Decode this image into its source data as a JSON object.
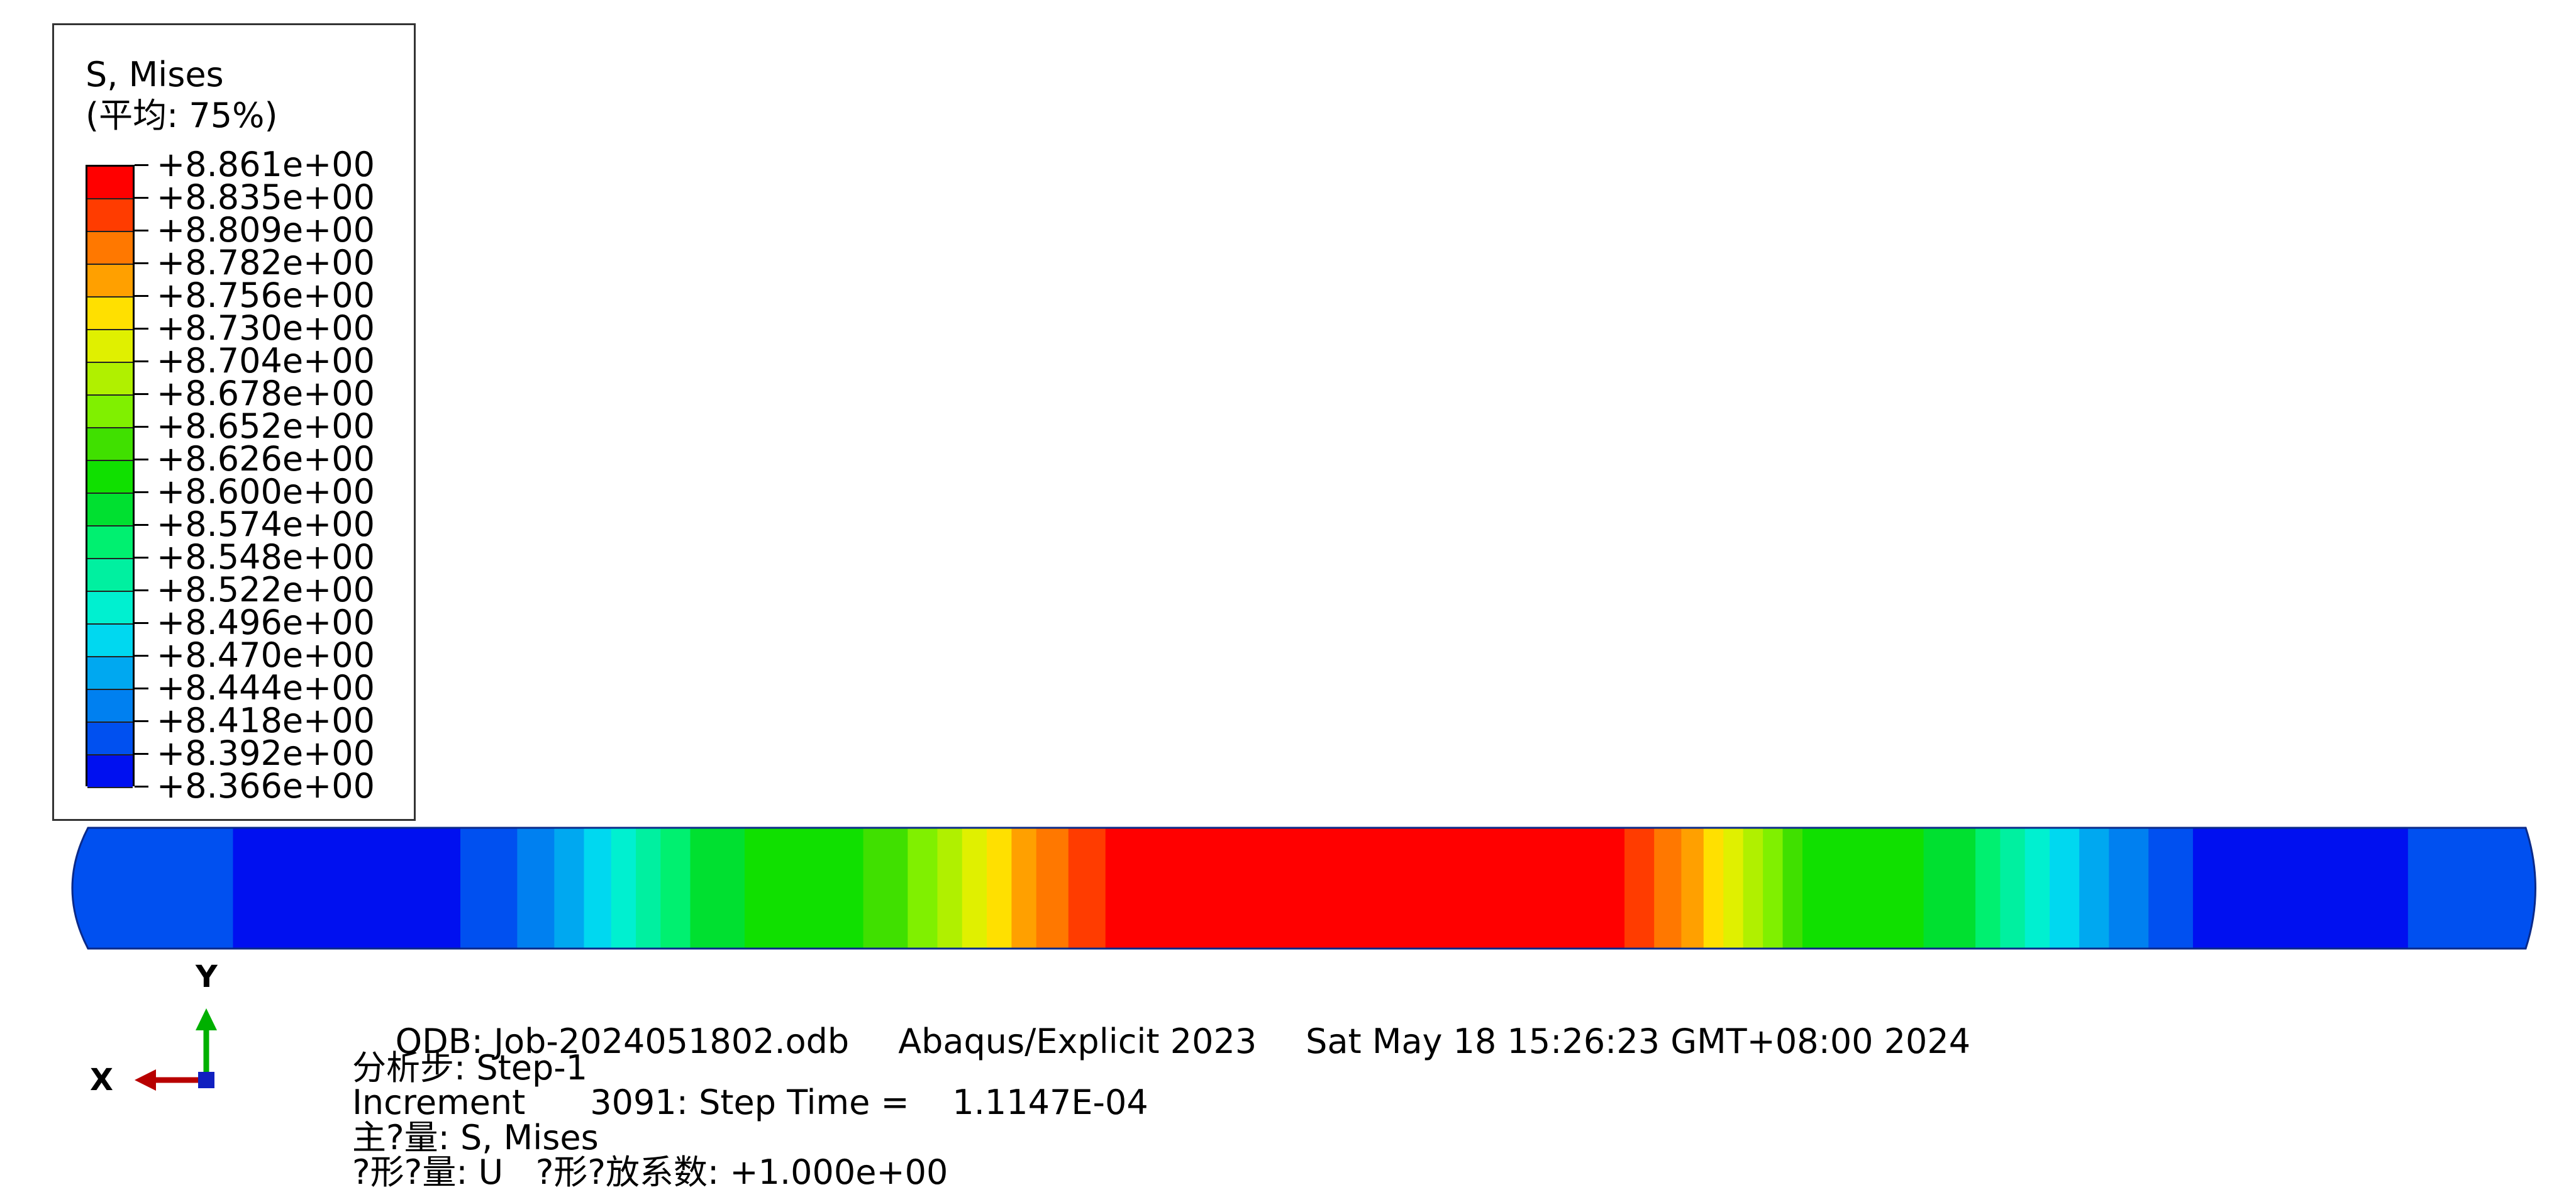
{
  "legend": {
    "title": "S, Mises",
    "subtitle": "(平均: 75%)",
    "labels": [
      "+8.861e+00",
      "+8.835e+00",
      "+8.809e+00",
      "+8.782e+00",
      "+8.756e+00",
      "+8.730e+00",
      "+8.704e+00",
      "+8.678e+00",
      "+8.652e+00",
      "+8.626e+00",
      "+8.600e+00",
      "+8.574e+00",
      "+8.548e+00",
      "+8.522e+00",
      "+8.496e+00",
      "+8.470e+00",
      "+8.444e+00",
      "+8.418e+00",
      "+8.392e+00",
      "+8.366e+00"
    ],
    "colors": [
      "#ff0000",
      "#ff3c00",
      "#ff7800",
      "#ffa000",
      "#ffe000",
      "#e0f000",
      "#b0f000",
      "#80f000",
      "#40e000",
      "#10e000",
      "#00e030",
      "#00f070",
      "#00f0a0",
      "#00f0d0",
      "#00d8f0",
      "#00a8f0",
      "#0080f0",
      "#0050f0",
      "#0010f0"
    ]
  },
  "triad": {
    "x_label": "X",
    "y_label": "Y"
  },
  "info": {
    "odb": "ODB: Job-2024051802.odb",
    "solver": "Abaqus/Explicit 2023",
    "date": "Sat May 18 15:26:23 GMT+08:00 2024",
    "step": "分析步: Step-1",
    "increment": "Increment      3091: Step Time =    1.1147E-04",
    "primary_var": "主?量: S, Mises",
    "deformed_var": "?形?量: U   ?形?放系数: +1.000e+00"
  },
  "model": {
    "bands": [
      {
        "color": "#0050f0",
        "from": 0.0,
        "to": 0.065
      },
      {
        "color": "#0010f0",
        "from": 0.065,
        "to": 0.157
      },
      {
        "color": "#0050f0",
        "from": 0.157,
        "to": 0.18
      },
      {
        "color": "#0080f0",
        "from": 0.18,
        "to": 0.195
      },
      {
        "color": "#00a8f0",
        "from": 0.195,
        "to": 0.207
      },
      {
        "color": "#00d8f0",
        "from": 0.207,
        "to": 0.218
      },
      {
        "color": "#00f0d0",
        "from": 0.218,
        "to": 0.228
      },
      {
        "color": "#00f0a0",
        "from": 0.228,
        "to": 0.238
      },
      {
        "color": "#00f070",
        "from": 0.238,
        "to": 0.25
      },
      {
        "color": "#00e030",
        "from": 0.25,
        "to": 0.272
      },
      {
        "color": "#10e000",
        "from": 0.272,
        "to": 0.32
      },
      {
        "color": "#40e000",
        "from": 0.32,
        "to": 0.338
      },
      {
        "color": "#80f000",
        "from": 0.338,
        "to": 0.35
      },
      {
        "color": "#b0f000",
        "from": 0.35,
        "to": 0.36
      },
      {
        "color": "#e0f000",
        "from": 0.36,
        "to": 0.37
      },
      {
        "color": "#ffe000",
        "from": 0.37,
        "to": 0.38
      },
      {
        "color": "#ffa000",
        "from": 0.38,
        "to": 0.39
      },
      {
        "color": "#ff7800",
        "from": 0.39,
        "to": 0.403
      },
      {
        "color": "#ff3c00",
        "from": 0.403,
        "to": 0.418
      },
      {
        "color": "#ff0000",
        "from": 0.418,
        "to": 0.628
      },
      {
        "color": "#ff3c00",
        "from": 0.628,
        "to": 0.64
      },
      {
        "color": "#ff7800",
        "from": 0.64,
        "to": 0.651
      },
      {
        "color": "#ffa000",
        "from": 0.651,
        "to": 0.66
      },
      {
        "color": "#ffe000",
        "from": 0.66,
        "to": 0.668
      },
      {
        "color": "#e0f000",
        "from": 0.668,
        "to": 0.676
      },
      {
        "color": "#b0f000",
        "from": 0.676,
        "to": 0.684
      },
      {
        "color": "#80f000",
        "from": 0.684,
        "to": 0.692
      },
      {
        "color": "#40e000",
        "from": 0.692,
        "to": 0.7
      },
      {
        "color": "#10e000",
        "from": 0.7,
        "to": 0.749
      },
      {
        "color": "#00e030",
        "from": 0.749,
        "to": 0.77
      },
      {
        "color": "#00f070",
        "from": 0.77,
        "to": 0.78
      },
      {
        "color": "#00f0a0",
        "from": 0.78,
        "to": 0.79
      },
      {
        "color": "#00f0d0",
        "from": 0.79,
        "to": 0.8
      },
      {
        "color": "#00d8f0",
        "from": 0.8,
        "to": 0.812
      },
      {
        "color": "#00a8f0",
        "from": 0.812,
        "to": 0.824
      },
      {
        "color": "#0080f0",
        "from": 0.824,
        "to": 0.84
      },
      {
        "color": "#0050f0",
        "from": 0.84,
        "to": 0.858
      },
      {
        "color": "#0010f0",
        "from": 0.858,
        "to": 0.945
      },
      {
        "color": "#0050f0",
        "from": 0.945,
        "to": 1.0
      }
    ]
  }
}
